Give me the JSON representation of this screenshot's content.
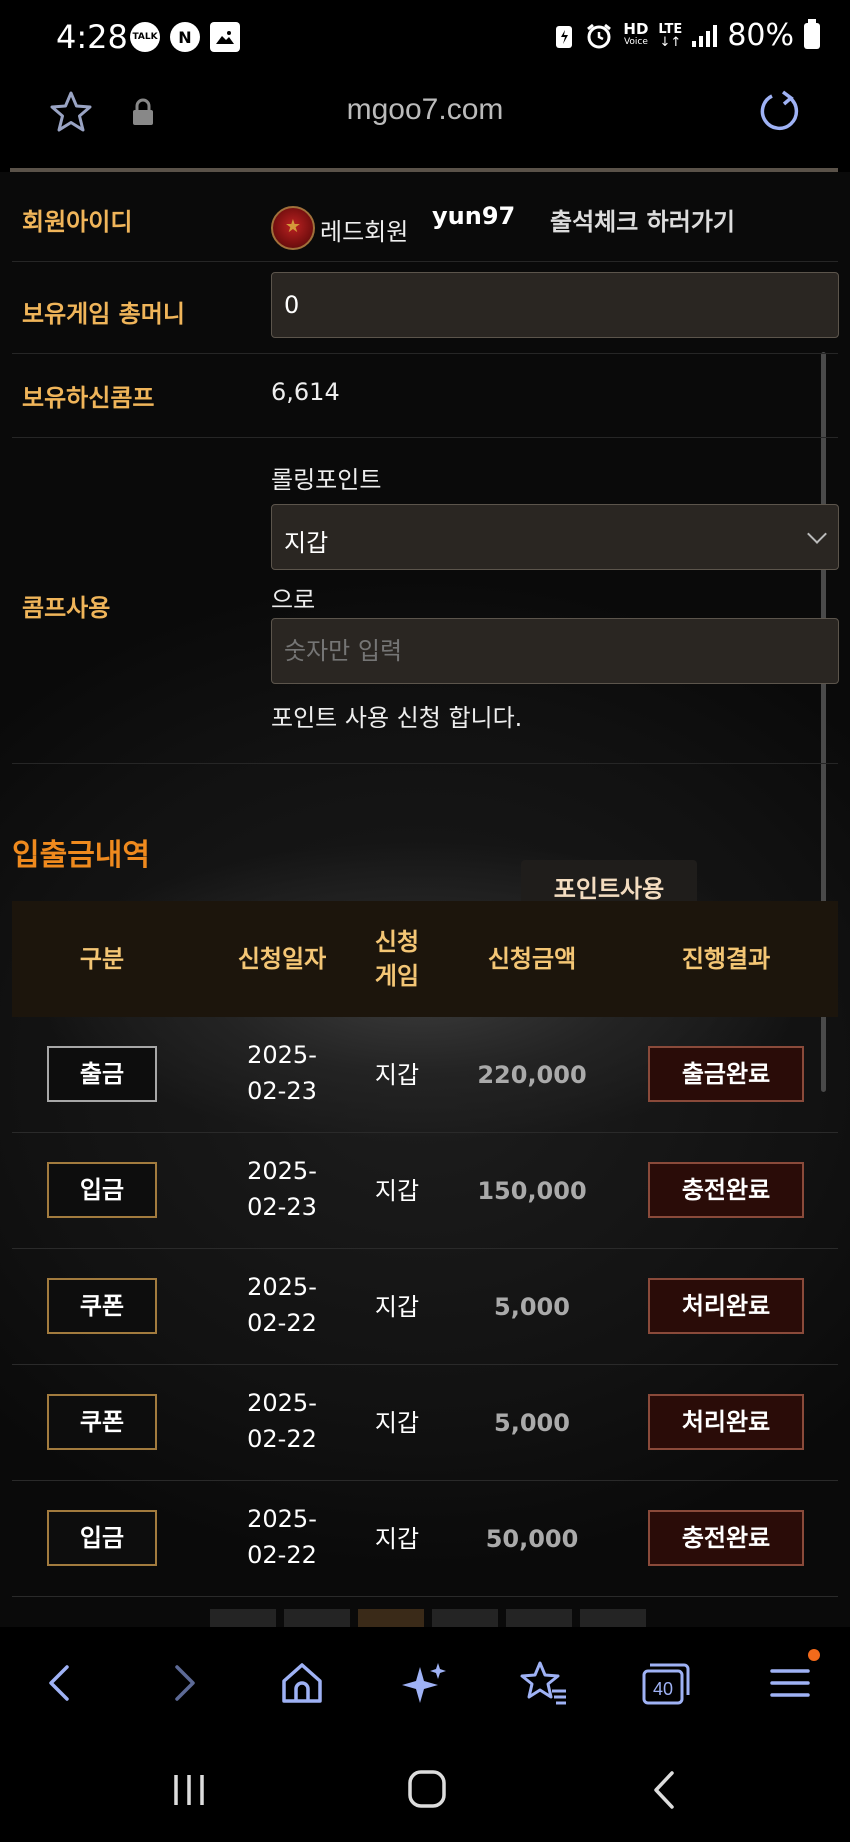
{
  "status_bar": {
    "time": "4:28",
    "left_icons": [
      "talk-icon",
      "naver-icon",
      "gallery-icon"
    ],
    "talk_label": "TALK",
    "naver_label": "N",
    "right_icons": [
      "battery-saver-icon",
      "alarm-icon",
      "hd-voice-icon",
      "lte-icon",
      "signal-icon",
      "battery-icon"
    ],
    "hd_label": "HD",
    "voice_label": "Voice",
    "lte_label": "LTE",
    "lte_arrows": "↓↑",
    "battery": "80%"
  },
  "browser": {
    "url": "mgoo7.com"
  },
  "member": {
    "id_label": "회원아이디",
    "grade": "레드회원",
    "username": "yun97",
    "attendance_link": "출석체크 하러가기",
    "game_money_label": "보유게임 총머니",
    "game_money_value": "0",
    "comp_label": "보유하신콤프",
    "comp_value": "6,614"
  },
  "comp_use": {
    "label": "콤프사용",
    "rolling_label": "롤링포인트",
    "select_value": "지갑",
    "to_label": "으로",
    "amount_placeholder": "숫자만 입력",
    "request_text": "포인트 사용 신청 합니다.",
    "button_label": "포인트사용"
  },
  "history": {
    "title": "입출금내역",
    "columns": [
      "구분",
      "신청일자",
      "신청\n게임",
      "신청금액",
      "진행결과"
    ],
    "rows": [
      {
        "type": "출금",
        "date_line1": "2025-",
        "date_line2": "02-23",
        "game": "지갑",
        "amount": "220,000",
        "status": "출금완료"
      },
      {
        "type": "입금",
        "date_line1": "2025-",
        "date_line2": "02-23",
        "game": "지갑",
        "amount": "150,000",
        "status": "충전완료"
      },
      {
        "type": "쿠폰",
        "date_line1": "2025-",
        "date_line2": "02-22",
        "game": "지갑",
        "amount": "5,000",
        "status": "처리완료"
      },
      {
        "type": "쿠폰",
        "date_line1": "2025-",
        "date_line2": "02-22",
        "game": "지갑",
        "amount": "5,000",
        "status": "처리완료"
      },
      {
        "type": "입금",
        "date_line1": "2025-",
        "date_line2": "02-22",
        "game": "지갑",
        "amount": "50,000",
        "status": "충전완료"
      }
    ]
  },
  "toolbar": {
    "items": [
      "back-icon",
      "forward-icon",
      "home-icon",
      "ai-sparkle-icon",
      "bookmarks-icon",
      "tabs-icon",
      "menu-icon"
    ],
    "tab_count": "40"
  },
  "colors": {
    "label_gold": "#f0b55a",
    "section_orange": "#ef8a1e",
    "toolbar_icon": "#9fb2f5",
    "notification_dot": "#f26a1b"
  }
}
